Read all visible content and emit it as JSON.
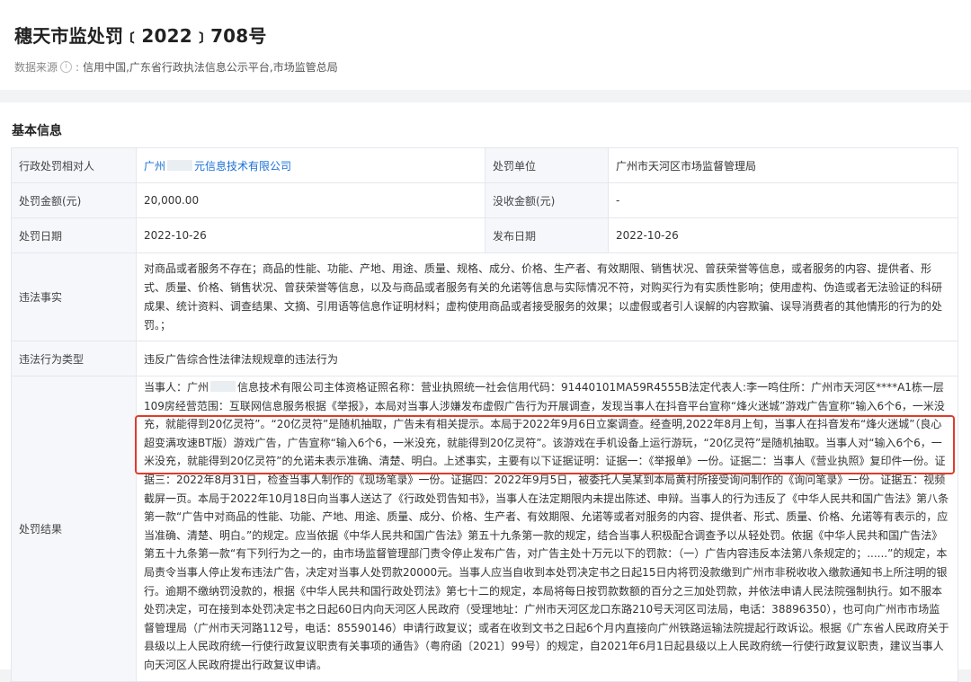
{
  "page": {
    "title": "穗天市监处罚﹝2022﹞708号",
    "source_label": "数据来源",
    "source_value": "信用中国,广东省行政执法信息公示平台,市场监管总局"
  },
  "section_title": "基本信息",
  "table": {
    "row1": {
      "label_a": "行政处罚相对人",
      "value_a_part1": "广州",
      "value_a_part2": "元信息技术有限公司",
      "label_b": "处罚单位",
      "value_b": "广州市天河区市场监督管理局"
    },
    "row2": {
      "label_a": "处罚金额(元)",
      "value_a": "20,000.00",
      "label_b": "没收金额(元)",
      "value_b": "-"
    },
    "row3": {
      "label_a": "处罚日期",
      "value_a": "2022-10-26",
      "label_b": "发布日期",
      "value_b": "2022-10-26"
    },
    "row4": {
      "label": "违法事实",
      "value": "对商品或者服务不存在；商品的性能、功能、产地、用途、质量、规格、成分、价格、生产者、有效期限、销售状况、曾获荣誉等信息，或者服务的内容、提供者、形式、质量、价格、销售状况、曾获荣誉等信息，以及与商品或者服务有关的允诺等信息与实际情况不符，对购买行为有实质性影响；使用虚构、伪造或者无法验证的科研成果、统计资料、调查结果、文摘、引用语等信息作证明材料；虚构使用商品或者接受服务的效果；以虚假或者引人误解的内容欺骗、误导消费者的其他情形的行为的处罚。；"
    },
    "row5": {
      "label": "违法行为类型",
      "value": "违反广告综合性法律法规规章的违法行为"
    },
    "row6": {
      "label": "处罚结果",
      "text_prefix": "当事人：广州",
      "text_body": "信息技术有限公司主体资格证照名称：营业执照统一社会信用代码：91440101MA59R4555B法定代表人:李一鸣住所：广州市天河区****A1栋一层109房经营范围：互联网信息服务根据《举报》，本局对当事人涉嫌发布虚假广告行为开展调查，发现当事人在抖音平台宣称“烽火迷城”游戏广告宣称“输入6个6，一米没充，就能得到20亿灵符”。“20亿灵符”是随机抽取，广告未有相关提示。本局于2022年9月6日立案调查。经查明,2022年8月上旬，当事人在抖音发布“烽火迷城”（良心超变满攻速BT版）游戏广告，广告宣称“输入6个6，一米没充，就能得到20亿灵符”。该游戏在手机设备上运行游玩，“20亿灵符”是随机抽取。当事人对“输入6个6，一米没充，就能得到20亿灵符”的允诺未表示准确、清楚、明白。上述事实，主要有以下证据证明：证据一：《举报单》一份。证据二：当事人《营业执照》复印件一份。证据三：2022年8月31日，检查当事人制作的《现场笔录》一份。证据四：2022年9月5日，被委托人吴某到本局黄村所接受询问制作的《询问笔录》一份。证据五：视频截屏一页。本局于2022年10月18日向当事人送达了《行政处罚告知书》，当事人在法定期限内未提出陈述、申辩。当事人的行为违反了《中华人民共和国广告法》第八条第一款“广告中对商品的性能、功能、产地、用途、质量、成分、价格、生产者、有效期限、允诺等或者对服务的内容、提供者、形式、质量、价格、允诺等有表示的，应当准确、清楚、明白。”的规定。应当依据《中华人民共和国广告法》第五十九条第一款的规定，结合当事人积极配合调查予以从轻处罚。依据《中华人民共和国广告法》第五十九条第一款“有下列行为之一的，由市场监督管理部门责令停止发布广告，对广告主处十万元以下的罚款：（一）广告内容违反本法第八条规定的；......”的规定，本局责令当事人停止发布违法广告，决定对当事人处罚款20000元。当事人应当自收到本处罚决定书之日起15日内将罚没款缴到广州市非税收收入缴款通知书上所注明的银行。逾期不缴纳罚没款的，根据《中华人民共和国行政处罚法》第七十二的规定，本局将每日按罚款数额的百分之三加处罚款，并依法申请人民法院强制执行。如不服本处罚决定，可在接到本处罚决定书之日起60日内向天河区人民政府（受理地址：广州市天河区龙口东路210号天河区司法局，电话：38896350），也可向广州市市场监督管理局（广州市天河路112号，电话：85590146）申请行政复议；或者在收到文书之日起6个月内直接向广州铁路运输法院提起行政诉讼。根据《广东省人民政府关于县级以上人民政府统一行使行政复议职责有关事项的通告》（粤府函〔2021〕99号）的规定，自2021年6月1日起县级以上人民政府统一行使行政复议职责，建议当事人向天河区人民政府提出行政复议申请。"
    }
  }
}
